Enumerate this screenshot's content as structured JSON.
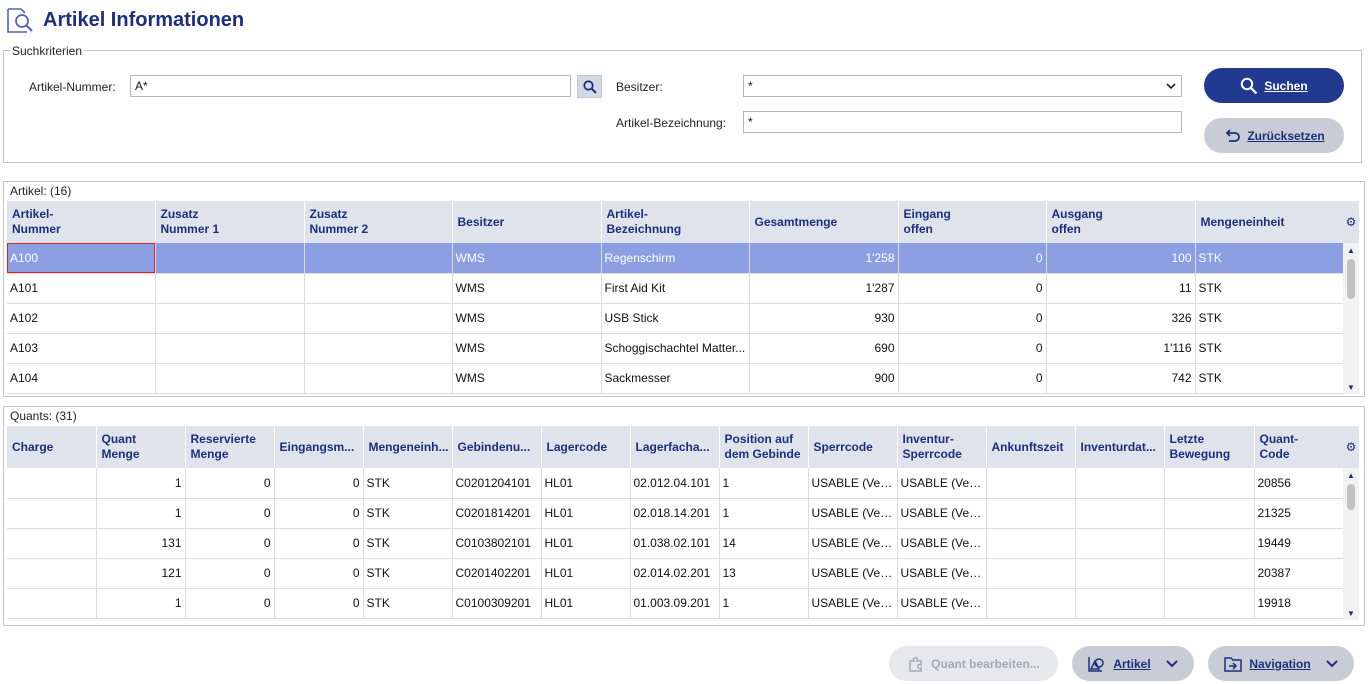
{
  "header": {
    "title": "Artikel Informationen",
    "icon": "artikel-search-icon"
  },
  "search": {
    "legend": "Suchkriterien",
    "artikel_nummer_label": "Artikel-Nummer:",
    "artikel_nummer_value": "A*",
    "besitzer_label": "Besitzer:",
    "besitzer_value": "*",
    "bezeichnung_label": "Artikel-Bezeichnung:",
    "bezeichnung_value": "*",
    "search_button": "Suchen",
    "reset_button": "Zurücksetzen"
  },
  "artikel": {
    "title": "Artikel: (16)",
    "columns": [
      [
        "Artikel-",
        "Nummer"
      ],
      [
        "Zusatz",
        "Nummer 1"
      ],
      [
        "Zusatz",
        "Nummer 2"
      ],
      [
        "Besitzer",
        ""
      ],
      [
        "Artikel-",
        "Bezeichnung"
      ],
      [
        "Gesamtmenge",
        ""
      ],
      [
        "Eingang",
        "offen"
      ],
      [
        "Ausgang",
        "offen"
      ],
      [
        "Mengeneinheit",
        ""
      ]
    ],
    "rows": [
      [
        "A100",
        "",
        "",
        "WMS",
        "Regenschirm",
        "1'258",
        "0",
        "100",
        "STK"
      ],
      [
        "A101",
        "",
        "",
        "WMS",
        "First Aid Kit",
        "1'287",
        "0",
        "11",
        "STK"
      ],
      [
        "A102",
        "",
        "",
        "WMS",
        "USB Stick",
        "930",
        "0",
        "326",
        "STK"
      ],
      [
        "A103",
        "",
        "",
        "WMS",
        "Schoggischachtel Matter...",
        "690",
        "0",
        "1'116",
        "STK"
      ],
      [
        "A104",
        "",
        "",
        "WMS",
        "Sackmesser",
        "900",
        "0",
        "742",
        "STK"
      ]
    ]
  },
  "quants": {
    "title": "Quants: (31)",
    "columns": [
      [
        "Charge",
        ""
      ],
      [
        "Quant",
        "Menge"
      ],
      [
        "Reservierte",
        "Menge"
      ],
      [
        "Eingangsm...",
        ""
      ],
      [
        "Mengeneinh...",
        ""
      ],
      [
        "Gebindenu...",
        ""
      ],
      [
        "Lagercode",
        ""
      ],
      [
        "Lagerfacha...",
        ""
      ],
      [
        "Position auf",
        "dem Gebinde"
      ],
      [
        "Sperrcode",
        ""
      ],
      [
        "Inventur-",
        "Sperrcode"
      ],
      [
        "Ankunftszeit",
        ""
      ],
      [
        "Inventurdat...",
        ""
      ],
      [
        "Letzte",
        "Bewegung"
      ],
      [
        "Quant-",
        "Code"
      ]
    ],
    "rows": [
      [
        "",
        "1",
        "0",
        "0",
        "STK",
        "C0201204101",
        "HL01",
        "02.012.04.101",
        "1",
        "USABLE (Ver...",
        "USABLE (Ver...",
        "",
        "",
        "",
        "20856"
      ],
      [
        "",
        "1",
        "0",
        "0",
        "STK",
        "C0201814201",
        "HL01",
        "02.018.14.201",
        "1",
        "USABLE (Ver...",
        "USABLE (Ver...",
        "",
        "",
        "",
        "21325"
      ],
      [
        "",
        "131",
        "0",
        "0",
        "STK",
        "C0103802101",
        "HL01",
        "01.038.02.101",
        "14",
        "USABLE (Ver...",
        "USABLE (Ver...",
        "",
        "",
        "",
        "19449"
      ],
      [
        "",
        "121",
        "0",
        "0",
        "STK",
        "C0201402201",
        "HL01",
        "02.014.02.201",
        "13",
        "USABLE (Ver...",
        "USABLE (Ver...",
        "",
        "",
        "",
        "20387"
      ],
      [
        "",
        "1",
        "0",
        "0",
        "STK",
        "C0100309201",
        "HL01",
        "01.003.09.201",
        "1",
        "USABLE (Ver...",
        "USABLE (Ver...",
        "",
        "",
        "",
        "19918"
      ]
    ]
  },
  "footer": {
    "quant_edit": "Quant bearbeiten...",
    "artikel": "Artikel",
    "navigation": "Navigation"
  },
  "colors": {
    "accent": "#213a8f",
    "header_bg": "#dfe3ec",
    "selected_row": "#8c9fe3",
    "title": "#1e2f7a"
  }
}
